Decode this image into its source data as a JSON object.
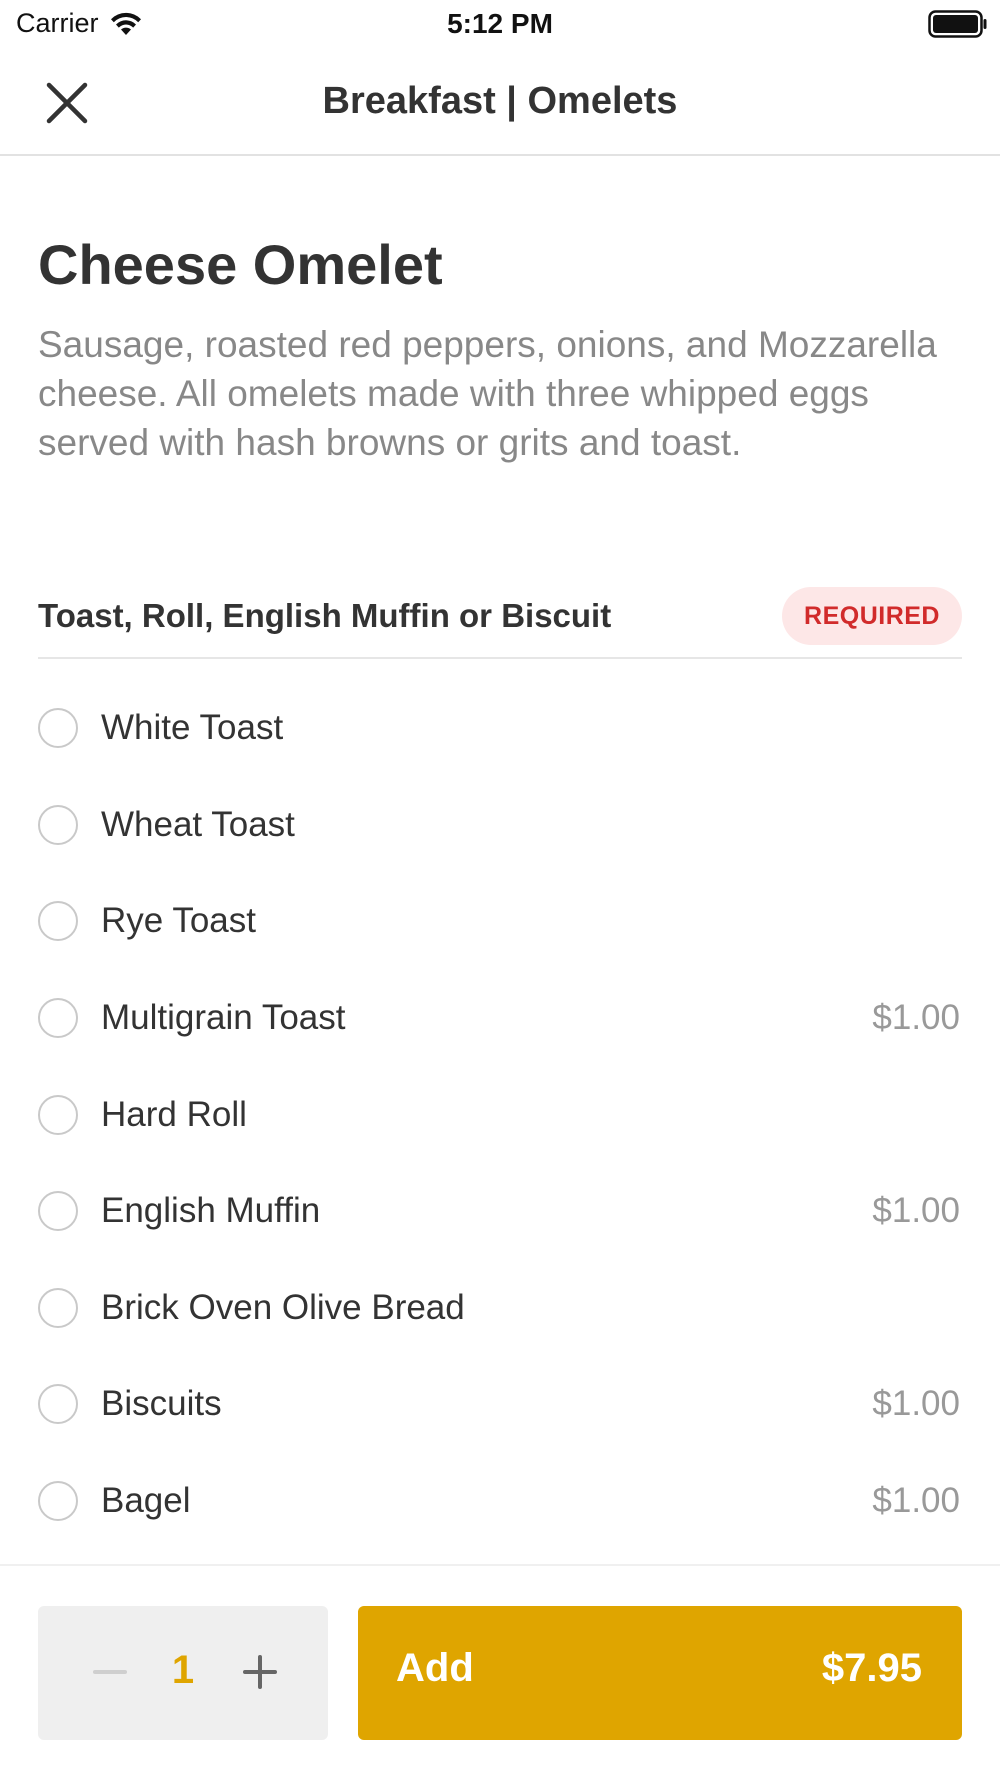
{
  "status_bar": {
    "carrier": "Carrier",
    "time": "5:12 PM"
  },
  "nav": {
    "title": "Breakfast | Omelets",
    "close_icon": "close-icon"
  },
  "item": {
    "name": "Cheese Omelet",
    "description": "Sausage, roasted red peppers, onions, and Mozzarella cheese. All omelets made with three whipped eggs served with hash browns or grits and toast."
  },
  "option_group": {
    "title": "Toast, Roll, English Muffin or Biscuit",
    "badge": "REQUIRED",
    "options": [
      {
        "label": "White Toast",
        "price": ""
      },
      {
        "label": "Wheat Toast",
        "price": ""
      },
      {
        "label": "Rye Toast",
        "price": ""
      },
      {
        "label": "Multigrain Toast",
        "price": "$1.00"
      },
      {
        "label": "Hard Roll",
        "price": ""
      },
      {
        "label": "English Muffin",
        "price": "$1.00"
      },
      {
        "label": "Brick Oven Olive Bread",
        "price": ""
      },
      {
        "label": "Biscuits",
        "price": "$1.00"
      },
      {
        "label": "Bagel",
        "price": "$1.00"
      }
    ]
  },
  "footer": {
    "quantity": "1",
    "add_label": "Add",
    "add_price": "$7.95"
  },
  "colors": {
    "accent": "#dfa500",
    "required_bg": "#fde7e7",
    "required_text": "#d12b2b"
  }
}
